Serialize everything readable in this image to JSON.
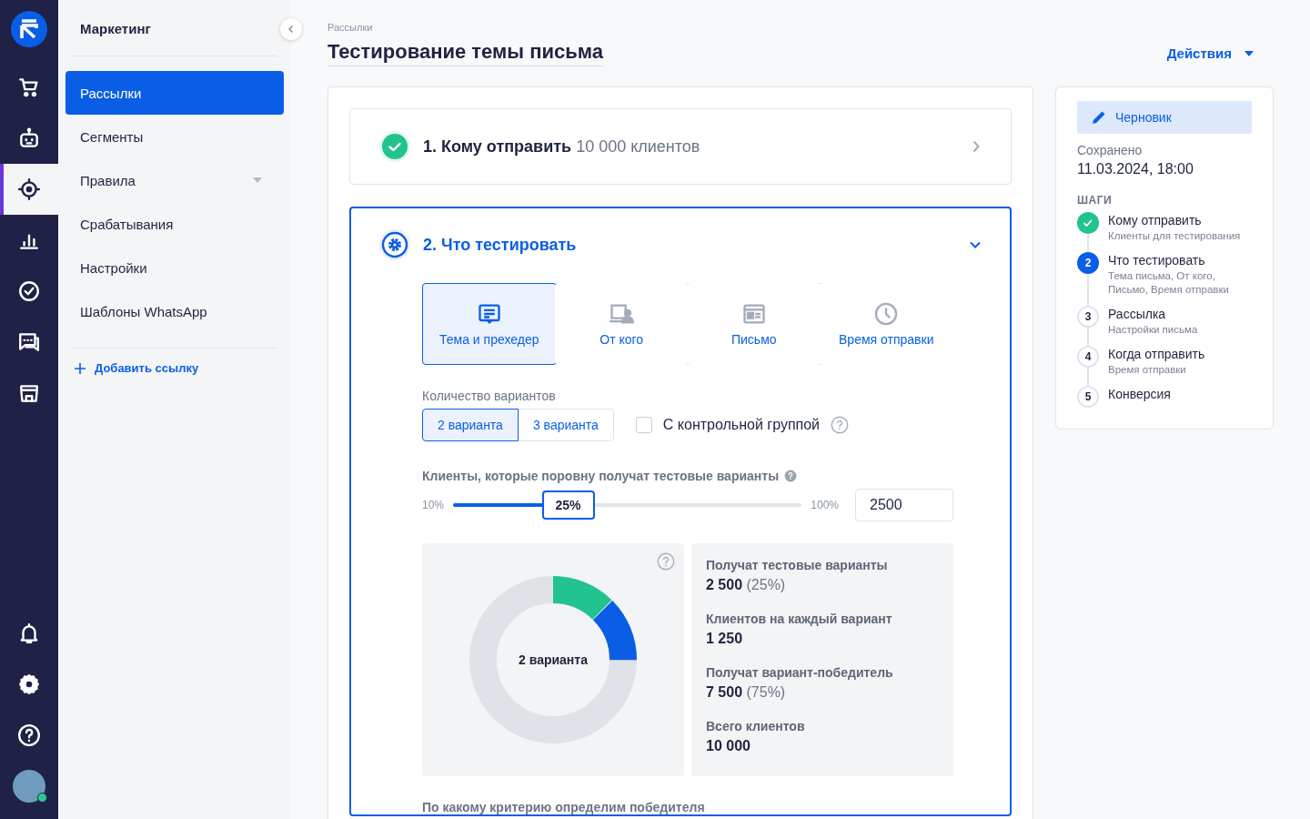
{
  "rail": {
    "items": [
      {
        "selected": false
      },
      {
        "selected": false
      },
      {
        "selected": true
      },
      {
        "selected": false
      },
      {
        "selected": false
      },
      {
        "selected": false
      },
      {
        "selected": false
      }
    ],
    "avatar": {
      "online": true
    }
  },
  "sidebar": {
    "title": "Маркетинг",
    "items": [
      {
        "label": "Рассылки",
        "selected": true,
        "expandable": false
      },
      {
        "label": "Сегменты",
        "selected": false,
        "expandable": false
      },
      {
        "label": "Правила",
        "selected": false,
        "expandable": true
      },
      {
        "label": "Срабатывания",
        "selected": false,
        "expandable": false
      },
      {
        "label": "Настройки",
        "selected": false,
        "expandable": false
      },
      {
        "label": "Шаблоны WhatsApp",
        "selected": false,
        "expandable": false
      }
    ],
    "add_link": "Добавить ссылку"
  },
  "breadcrumb": "Рассылки",
  "title": "Тестирование темы письма",
  "actions": "Действия",
  "sections": [
    {
      "title": "1. Кому отправить",
      "summary": "10 000 клиентов",
      "kind": "done",
      "expanded": false
    },
    {
      "title": "2. Что тестировать",
      "kind": "current",
      "expanded": true
    }
  ],
  "test_tabs": [
    {
      "label": "Тема и прехедер",
      "selected": true
    },
    {
      "label": "От кого",
      "selected": false
    },
    {
      "label": "Письмо",
      "selected": false
    },
    {
      "label": "Время отправки",
      "selected": false
    }
  ],
  "variants": {
    "label": "Количество вариантов",
    "options": [
      {
        "label": "2 варианта",
        "selected": true
      },
      {
        "label": "3 варианта",
        "selected": false
      }
    ],
    "control_group": {
      "label": "С контрольной группой",
      "checked": false
    }
  },
  "audience": {
    "label": "Клиенты, которые поровну получат тестовые варианты",
    "min": "10%",
    "max": "100%",
    "thumb": "25%",
    "level": 0.33,
    "count": "2500"
  },
  "distribution": {
    "center": "2 варианта",
    "stats": [
      {
        "label": "Получат тестовые варианты",
        "value": "2 500",
        "note": "(25%)"
      },
      {
        "label": "Клиентов на каждый вариант",
        "value": "1 250"
      },
      {
        "label": "Получат вариант-победитель",
        "value": "7 500",
        "note": "(75%)"
      },
      {
        "label": "Всего клиентов",
        "value": "10 000"
      }
    ]
  },
  "criterion_label": "По какому критерию определим победителя",
  "status_panel": {
    "badge": "Черновик",
    "saved_label": "Сохранено",
    "saved_at": "11.03.2024, 18:00",
    "steps_heading": "ШАГИ",
    "steps": [
      {
        "kind": "done",
        "title": "Кому отправить",
        "subtitle": "Клиенты для тестирования"
      },
      {
        "kind": "current",
        "marker": "2",
        "title": "Что тестировать",
        "subtitle": "Тема письма, От кого, Письмо, Время отправки"
      },
      {
        "kind": "pending",
        "marker": "3",
        "title": "Рассылка",
        "subtitle": "Настройки письма"
      },
      {
        "kind": "pending",
        "marker": "4",
        "title": "Когда отправить",
        "subtitle": "Время отправки"
      },
      {
        "kind": "pending",
        "marker": "5",
        "title": "Конверсия"
      }
    ]
  }
}
